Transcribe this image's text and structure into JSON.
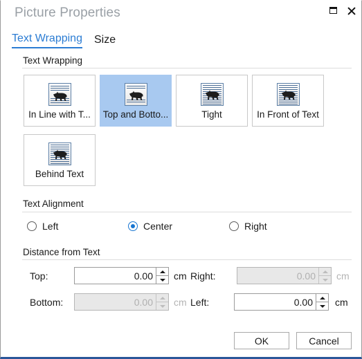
{
  "window": {
    "title": "Picture Properties",
    "restore_icon": "restore-window-icon",
    "close_icon": "close-window-icon"
  },
  "tabs": [
    {
      "label": "Text Wrapping",
      "active": true
    },
    {
      "label": "Size",
      "active": false
    }
  ],
  "groups": {
    "text_wrapping": "Text Wrapping",
    "text_alignment": "Text Alignment",
    "distance_from_text": "Distance from Text"
  },
  "wrapping_options": [
    {
      "label": "In Line with T...",
      "icon": "wrap-inline-with-text-icon",
      "selected": false,
      "outlined": true
    },
    {
      "label": "Top and Botto...",
      "icon": "wrap-top-and-bottom-icon",
      "selected": true,
      "outlined": false
    },
    {
      "label": "Tight",
      "icon": "wrap-tight-icon",
      "selected": false,
      "outlined": true
    },
    {
      "label": "In Front of Text",
      "icon": "wrap-in-front-of-text-icon",
      "selected": false,
      "outlined": true
    },
    {
      "label": "Behind Text",
      "icon": "wrap-behind-text-icon",
      "selected": false,
      "outlined": true
    }
  ],
  "alignment": {
    "options": [
      {
        "label": "Left",
        "checked": false
      },
      {
        "label": "Center",
        "checked": true
      },
      {
        "label": "Right",
        "checked": false
      }
    ]
  },
  "distance": {
    "top": {
      "label": "Top:",
      "value": "0.00",
      "unit": "cm",
      "enabled": true
    },
    "bottom": {
      "label": "Bottom:",
      "value": "0.00",
      "unit": "cm",
      "enabled": false
    },
    "right": {
      "label": "Right:",
      "value": "0.00",
      "unit": "cm",
      "enabled": false
    },
    "left": {
      "label": "Left:",
      "value": "0.00",
      "unit": "cm",
      "enabled": true
    }
  },
  "footer": {
    "ok": "OK",
    "cancel": "Cancel"
  },
  "colors": {
    "accent": "#2b7cd3",
    "selection": "#a8c9f0",
    "bottom_border": "#2a5699",
    "title_text": "#9aa0a6"
  }
}
